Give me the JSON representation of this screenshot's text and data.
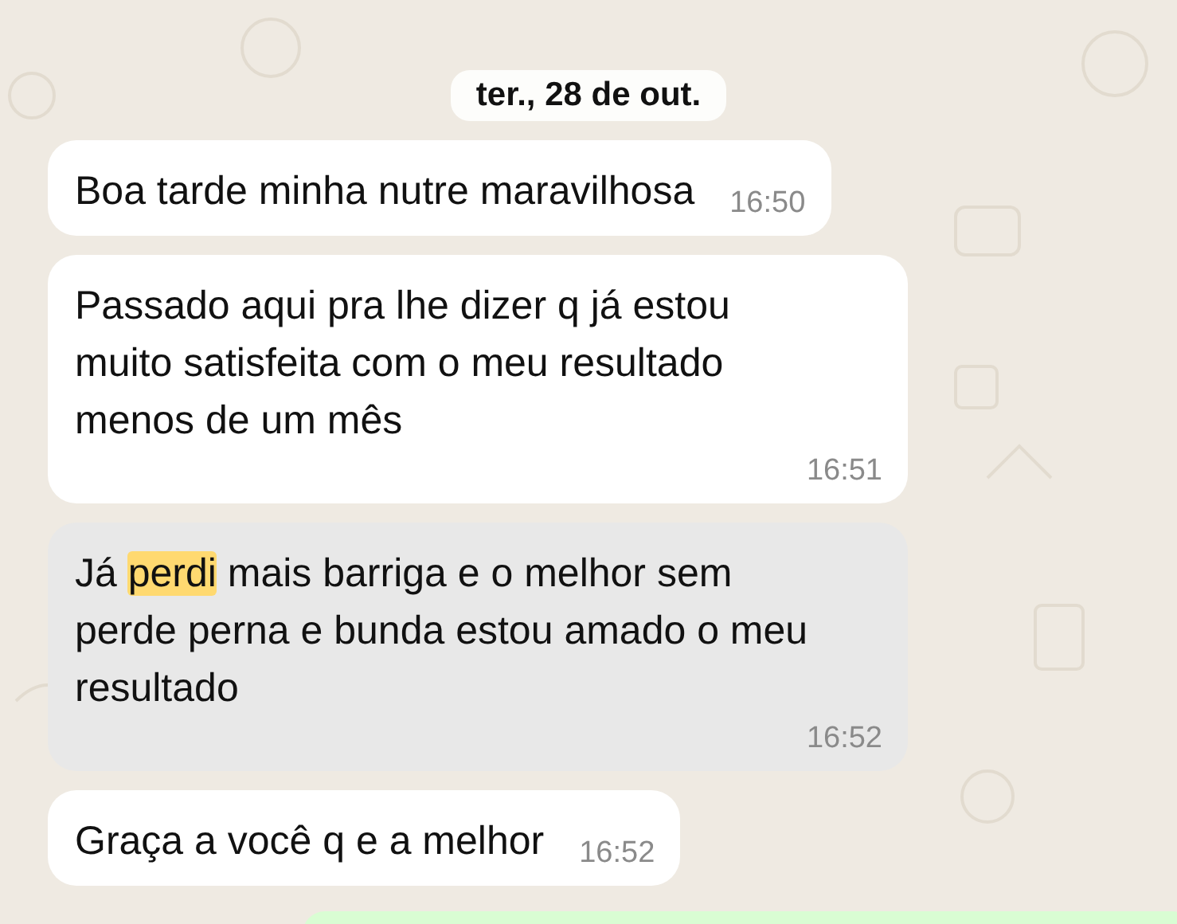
{
  "date_pill": "ter., 28 de out.",
  "messages": [
    {
      "selected": false,
      "segments": [
        {
          "text": "Boa tarde minha nutre maravilhosa",
          "highlighted": false
        }
      ],
      "time": "16:50"
    },
    {
      "selected": false,
      "segments": [
        {
          "text": "Passado aqui pra lhe dizer q já estou muito satisfeita com o meu resultado menos de um mês",
          "highlighted": false
        }
      ],
      "time": "16:51"
    },
    {
      "selected": true,
      "segments": [
        {
          "text": "Já ",
          "highlighted": false
        },
        {
          "text": "perdi",
          "highlighted": true
        },
        {
          "text": " mais barriga e o melhor sem perde perna e bunda estou amado o meu resultado",
          "highlighted": false
        }
      ],
      "time": "16:52"
    },
    {
      "selected": false,
      "segments": [
        {
          "text": "Graça a você q e a melhor",
          "highlighted": false
        }
      ],
      "time": "16:52"
    }
  ]
}
